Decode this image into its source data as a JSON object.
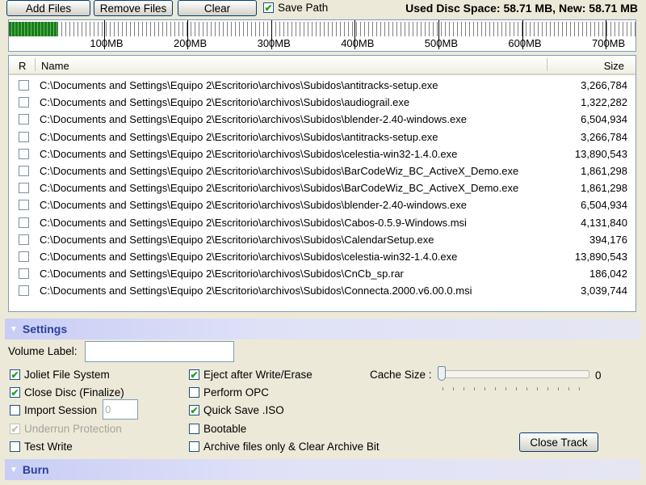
{
  "toolbar": {
    "add_files": "Add Files",
    "remove_files": "Remove Files",
    "clear": "Clear",
    "save_path": "Save Path",
    "save_path_checked": true,
    "disc_space": "Used Disc Space: 58.71 MB, New: 58.71 MB"
  },
  "gauge": {
    "used_mb": 58.71,
    "labels": [
      "100MB",
      "200MB",
      "300MB",
      "400MB",
      "500MB",
      "600MB",
      "700MB"
    ]
  },
  "file_list": {
    "col_r": "R",
    "col_name": "Name",
    "col_size": "Size",
    "rows": [
      {
        "name": "C:\\Documents and Settings\\Equipo 2\\Escritorio\\archivos\\Subidos\\antitracks-setup.exe",
        "size": "3,266,784"
      },
      {
        "name": "C:\\Documents and Settings\\Equipo 2\\Escritorio\\archivos\\Subidos\\audiograil.exe",
        "size": "1,322,282"
      },
      {
        "name": "C:\\Documents and Settings\\Equipo 2\\Escritorio\\archivos\\Subidos\\blender-2.40-windows.exe",
        "size": "6,504,934"
      },
      {
        "name": "C:\\Documents and Settings\\Equipo 2\\Escritorio\\archivos\\Subidos\\antitracks-setup.exe",
        "size": "3,266,784"
      },
      {
        "name": "C:\\Documents and Settings\\Equipo 2\\Escritorio\\archivos\\Subidos\\celestia-win32-1.4.0.exe",
        "size": "13,890,543"
      },
      {
        "name": "C:\\Documents and Settings\\Equipo 2\\Escritorio\\archivos\\Subidos\\BarCodeWiz_BC_ActiveX_Demo.exe",
        "size": "1,861,298"
      },
      {
        "name": "C:\\Documents and Settings\\Equipo 2\\Escritorio\\archivos\\Subidos\\BarCodeWiz_BC_ActiveX_Demo.exe",
        "size": "1,861,298"
      },
      {
        "name": "C:\\Documents and Settings\\Equipo 2\\Escritorio\\archivos\\Subidos\\blender-2.40-windows.exe",
        "size": "6,504,934"
      },
      {
        "name": "C:\\Documents and Settings\\Equipo 2\\Escritorio\\archivos\\Subidos\\Cabos-0.5.9-Windows.msi",
        "size": "4,131,840"
      },
      {
        "name": "C:\\Documents and Settings\\Equipo 2\\Escritorio\\archivos\\Subidos\\CalendarSetup.exe",
        "size": "394,176"
      },
      {
        "name": "C:\\Documents and Settings\\Equipo 2\\Escritorio\\archivos\\Subidos\\celestia-win32-1.4.0.exe",
        "size": "13,890,543"
      },
      {
        "name": "C:\\Documents and Settings\\Equipo 2\\Escritorio\\archivos\\Subidos\\CnCb_sp.rar",
        "size": "186,042"
      },
      {
        "name": "C:\\Documents and Settings\\Equipo 2\\Escritorio\\archivos\\Subidos\\Connecta.2000.v6.00.0.msi",
        "size": "3,039,744"
      }
    ]
  },
  "settings": {
    "header": "Settings",
    "volume_label": "Volume Label:",
    "volume_value": "",
    "joliet": "Joliet File System",
    "close_disc": "Close Disc (Finalize)",
    "import_session": "Import Session",
    "import_session_value": "0",
    "underrun": "Underrun Protection",
    "test_write": "Test Write",
    "eject": "Eject after Write/Erase",
    "perform_opc": "Perform OPC",
    "quick_save": "Quick Save .ISO",
    "bootable": "Bootable",
    "archive_only": "Archive files only & Clear Archive Bit",
    "cache_size": "Cache Size :",
    "cache_value": "0",
    "close_track": "Close Track",
    "check_mark": "✔"
  },
  "burn": {
    "header": "Burn"
  },
  "colors": {
    "section_text": "#2c3f9a",
    "gauge_used": "#1e7a1e",
    "check": "#21a121"
  }
}
